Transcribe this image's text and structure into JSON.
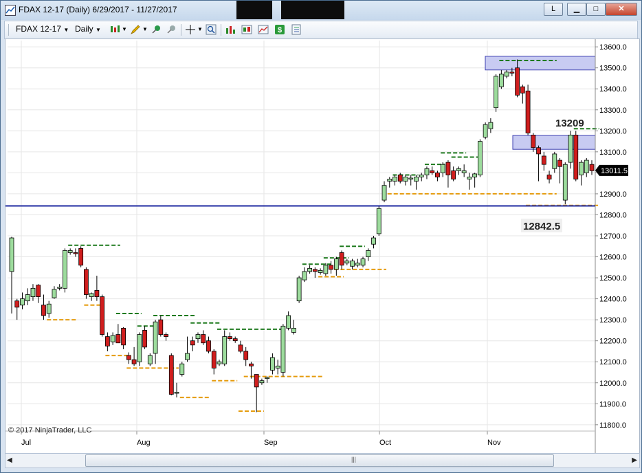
{
  "window": {
    "title": "FDAX 12-17 (Daily)  6/29/2017 - 11/27/2017",
    "buttons": {
      "l": "L",
      "minimize": "▁",
      "maximize": "□",
      "close": "✕"
    }
  },
  "toolbar": {
    "instrument": "FDAX 12-17",
    "interval": "Daily",
    "icons": [
      "candlestick-style-icon",
      "pencil-draw-icon",
      "pin-icon",
      "pin-gray-icon",
      "crosshair-icon",
      "zoom-icon",
      "bar-chart-icon",
      "chart-area-icon",
      "dollar-icon",
      "properties-icon"
    ]
  },
  "chart_data": {
    "type": "candlestick",
    "title": "FDAX 12-17 (Daily)",
    "ylim": [
      11770,
      13630
    ],
    "y_ticks": [
      "13600.0",
      "13500.0",
      "13400.0",
      "13300.0",
      "13200.0",
      "13100.0",
      "13000.0",
      "12900.0",
      "12800.0",
      "12700.0",
      "12600.0",
      "12500.0",
      "12400.0",
      "12300.0",
      "12200.0",
      "12100.0",
      "12000.0",
      "11900.0",
      "11800.0"
    ],
    "x_labels": [
      "Jul",
      "Aug",
      "Sep",
      "Oct",
      "Nov"
    ],
    "last_price": "13011.5",
    "copyright": "© 2017 NinjaTrader, LLC",
    "annotations": {
      "high_label": "13209",
      "low_label": "12842.5"
    },
    "colors": {
      "up": "#9ddc9d",
      "down": "#d01e1e",
      "support_level": "#1f2aa0",
      "resistance": "#1e7a1e",
      "support": "#e59b0c",
      "zone": "#c8cbf2"
    },
    "horizontal_line": 12842.5,
    "zones": [
      {
        "from": 13490,
        "to": 13555
      },
      {
        "from": 13112,
        "to": 13178
      }
    ],
    "candles": [
      {
        "o": 12530,
        "h": 12695,
        "l": 12330,
        "c": 12690
      },
      {
        "o": 12390,
        "h": 12400,
        "l": 12300,
        "c": 12360
      },
      {
        "o": 12370,
        "h": 12430,
        "l": 12350,
        "c": 12400
      },
      {
        "o": 12390,
        "h": 12450,
        "l": 12370,
        "c": 12420
      },
      {
        "o": 12410,
        "h": 12470,
        "l": 12390,
        "c": 12450
      },
      {
        "o": 12465,
        "h": 12470,
        "l": 12380,
        "c": 12410
      },
      {
        "o": 12370,
        "h": 12420,
        "l": 12300,
        "c": 12320
      },
      {
        "o": 12330,
        "h": 12390,
        "l": 12310,
        "c": 12375
      },
      {
        "o": 12405,
        "h": 12460,
        "l": 12400,
        "c": 12445
      },
      {
        "o": 12450,
        "h": 12470,
        "l": 12440,
        "c": 12455
      },
      {
        "o": 12450,
        "h": 12640,
        "l": 12430,
        "c": 12630
      },
      {
        "o": 12620,
        "h": 12640,
        "l": 12610,
        "c": 12630
      },
      {
        "o": 12620,
        "h": 12640,
        "l": 12600,
        "c": 12615
      },
      {
        "o": 12640,
        "h": 12650,
        "l": 12550,
        "c": 12560
      },
      {
        "o": 12540,
        "h": 12550,
        "l": 12400,
        "c": 12420
      },
      {
        "o": 12410,
        "h": 12430,
        "l": 12390,
        "c": 12425
      },
      {
        "o": 12440,
        "h": 12510,
        "l": 12390,
        "c": 12410
      },
      {
        "o": 12410,
        "h": 12420,
        "l": 12220,
        "c": 12230
      },
      {
        "o": 12220,
        "h": 12240,
        "l": 12150,
        "c": 12175
      },
      {
        "o": 12195,
        "h": 12240,
        "l": 12180,
        "c": 12225
      },
      {
        "o": 12230,
        "h": 12280,
        "l": 12200,
        "c": 12190
      },
      {
        "o": 12260,
        "h": 12265,
        "l": 12160,
        "c": 12180
      },
      {
        "o": 12130,
        "h": 12145,
        "l": 12090,
        "c": 12110
      },
      {
        "o": 12110,
        "h": 12170,
        "l": 12080,
        "c": 12090
      },
      {
        "o": 12100,
        "h": 12240,
        "l": 12080,
        "c": 12230
      },
      {
        "o": 12250,
        "h": 12270,
        "l": 12160,
        "c": 12170
      },
      {
        "o": 12090,
        "h": 12140,
        "l": 12080,
        "c": 12130
      },
      {
        "o": 12140,
        "h": 12300,
        "l": 12090,
        "c": 12290
      },
      {
        "o": 12300,
        "h": 12320,
        "l": 12220,
        "c": 12230
      },
      {
        "o": 12230,
        "h": 12240,
        "l": 12200,
        "c": 12220
      },
      {
        "o": 12130,
        "h": 12140,
        "l": 11940,
        "c": 11945
      },
      {
        "o": 11950,
        "h": 12000,
        "l": 11930,
        "c": 11955
      },
      {
        "o": 12040,
        "h": 12100,
        "l": 12030,
        "c": 12090
      },
      {
        "o": 12110,
        "h": 12220,
        "l": 12100,
        "c": 12140
      },
      {
        "o": 12200,
        "h": 12220,
        "l": 12150,
        "c": 12180
      },
      {
        "o": 12210,
        "h": 12240,
        "l": 12190,
        "c": 12230
      },
      {
        "o": 12230,
        "h": 12250,
        "l": 12180,
        "c": 12190
      },
      {
        "o": 12200,
        "h": 12220,
        "l": 12140,
        "c": 12150
      },
      {
        "o": 12150,
        "h": 12160,
        "l": 12040,
        "c": 12070
      },
      {
        "o": 12090,
        "h": 12110,
        "l": 12080,
        "c": 12100
      },
      {
        "o": 12090,
        "h": 12250,
        "l": 12080,
        "c": 12220
      },
      {
        "o": 12220,
        "h": 12240,
        "l": 12200,
        "c": 12210
      },
      {
        "o": 12210,
        "h": 12220,
        "l": 12190,
        "c": 12200
      },
      {
        "o": 12180,
        "h": 12200,
        "l": 12140,
        "c": 12150
      },
      {
        "o": 12150,
        "h": 12170,
        "l": 12080,
        "c": 12110
      },
      {
        "o": 12090,
        "h": 12100,
        "l": 12020,
        "c": 12080
      },
      {
        "o": 12040,
        "h": 12040,
        "l": 11860,
        "c": 11980
      },
      {
        "o": 12000,
        "h": 12020,
        "l": 11990,
        "c": 12010
      },
      {
        "o": 12020,
        "h": 12030,
        "l": 12000,
        "c": 12025
      },
      {
        "o": 12060,
        "h": 12140,
        "l": 12040,
        "c": 12120
      },
      {
        "o": 12070,
        "h": 12110,
        "l": 12040,
        "c": 12080
      },
      {
        "o": 12050,
        "h": 12280,
        "l": 12030,
        "c": 12270
      },
      {
        "o": 12260,
        "h": 12340,
        "l": 12250,
        "c": 12320
      },
      {
        "o": 12240,
        "h": 12300,
        "l": 12230,
        "c": 12260
      },
      {
        "o": 12390,
        "h": 12510,
        "l": 12380,
        "c": 12500
      },
      {
        "o": 12490,
        "h": 12550,
        "l": 12480,
        "c": 12530
      },
      {
        "o": 12530,
        "h": 12560,
        "l": 12520,
        "c": 12545
      },
      {
        "o": 12540,
        "h": 12550,
        "l": 12500,
        "c": 12530
      },
      {
        "o": 12525,
        "h": 12545,
        "l": 12515,
        "c": 12535
      },
      {
        "o": 12520,
        "h": 12570,
        "l": 12510,
        "c": 12560
      },
      {
        "o": 12560,
        "h": 12580,
        "l": 12520,
        "c": 12540
      },
      {
        "o": 12540,
        "h": 12600,
        "l": 12510,
        "c": 12590
      },
      {
        "o": 12620,
        "h": 12630,
        "l": 12540,
        "c": 12560
      },
      {
        "o": 12570,
        "h": 12590,
        "l": 12560,
        "c": 12580
      },
      {
        "o": 12555,
        "h": 12590,
        "l": 12540,
        "c": 12580
      },
      {
        "o": 12560,
        "h": 12590,
        "l": 12550,
        "c": 12570
      },
      {
        "o": 12560,
        "h": 12600,
        "l": 12550,
        "c": 12590
      },
      {
        "o": 12600,
        "h": 12640,
        "l": 12580,
        "c": 12630
      },
      {
        "o": 12660,
        "h": 12700,
        "l": 12640,
        "c": 12690
      },
      {
        "o": 12710,
        "h": 12840,
        "l": 12700,
        "c": 12830
      },
      {
        "o": 12870,
        "h": 12960,
        "l": 12860,
        "c": 12940
      },
      {
        "o": 12960,
        "h": 12980,
        "l": 12930,
        "c": 12970
      },
      {
        "o": 12960,
        "h": 12990,
        "l": 12940,
        "c": 12980
      },
      {
        "o": 12990,
        "h": 13000,
        "l": 12950,
        "c": 12960
      },
      {
        "o": 12960,
        "h": 12990,
        "l": 12940,
        "c": 12980
      },
      {
        "o": 12970,
        "h": 12990,
        "l": 12940,
        "c": 12975
      },
      {
        "o": 12960,
        "h": 12990,
        "l": 12920,
        "c": 12980
      },
      {
        "o": 12980,
        "h": 13000,
        "l": 12960,
        "c": 12990
      },
      {
        "o": 12990,
        "h": 13030,
        "l": 12970,
        "c": 13020
      },
      {
        "o": 13010,
        "h": 13030,
        "l": 12990,
        "c": 13000
      },
      {
        "o": 13000,
        "h": 13010,
        "l": 12960,
        "c": 12980
      },
      {
        "o": 13000,
        "h": 13050,
        "l": 12980,
        "c": 13040
      },
      {
        "o": 13050,
        "h": 13060,
        "l": 12930,
        "c": 12990
      },
      {
        "o": 13010,
        "h": 13030,
        "l": 12960,
        "c": 12970
      },
      {
        "o": 13010,
        "h": 13030,
        "l": 12990,
        "c": 13020
      },
      {
        "o": 13000,
        "h": 13040,
        "l": 12980,
        "c": 13010
      },
      {
        "o": 12970,
        "h": 13000,
        "l": 12920,
        "c": 12980
      },
      {
        "o": 12980,
        "h": 13000,
        "l": 12930,
        "c": 12995
      },
      {
        "o": 12990,
        "h": 13160,
        "l": 12980,
        "c": 13150
      },
      {
        "o": 13170,
        "h": 13240,
        "l": 13160,
        "c": 13230
      },
      {
        "o": 13210,
        "h": 13260,
        "l": 13190,
        "c": 13240
      },
      {
        "o": 13310,
        "h": 13470,
        "l": 13290,
        "c": 13460
      },
      {
        "o": 13410,
        "h": 13490,
        "l": 13400,
        "c": 13470
      },
      {
        "o": 13460,
        "h": 13490,
        "l": 13450,
        "c": 13480
      },
      {
        "o": 13480,
        "h": 13500,
        "l": 13460,
        "c": 13475
      },
      {
        "o": 13500,
        "h": 13540,
        "l": 13360,
        "c": 13370
      },
      {
        "o": 13410,
        "h": 13420,
        "l": 13330,
        "c": 13380
      },
      {
        "o": 13390,
        "h": 13420,
        "l": 13180,
        "c": 13190
      },
      {
        "o": 13180,
        "h": 13190,
        "l": 13100,
        "c": 13120
      },
      {
        "o": 13120,
        "h": 13130,
        "l": 12960,
        "c": 13090
      },
      {
        "o": 13080,
        "h": 13100,
        "l": 13010,
        "c": 13040
      },
      {
        "o": 12990,
        "h": 13010,
        "l": 12950,
        "c": 12970
      },
      {
        "o": 13020,
        "h": 13100,
        "l": 13000,
        "c": 13090
      },
      {
        "o": 13060,
        "h": 13070,
        "l": 12950,
        "c": 13030
      },
      {
        "o": 12870,
        "h": 13050,
        "l": 12850,
        "c": 13040
      },
      {
        "o": 13050,
        "h": 13200,
        "l": 13020,
        "c": 13180
      },
      {
        "o": 13180,
        "h": 13200,
        "l": 12960,
        "c": 12970
      },
      {
        "o": 12990,
        "h": 13060,
        "l": 12940,
        "c": 13050
      },
      {
        "o": 13000,
        "h": 13070,
        "l": 12980,
        "c": 13060
      },
      {
        "o": 13040,
        "h": 13060,
        "l": 12990,
        "c": 13010
      }
    ],
    "resistance_lines": [
      {
        "y": 12655,
        "from": 11,
        "to": 20
      },
      {
        "y": 12330,
        "from": 20,
        "to": 24
      },
      {
        "y": 12270,
        "from": 24,
        "to": 27
      },
      {
        "y": 12320,
        "from": 27,
        "to": 34
      },
      {
        "y": 12285,
        "from": 34,
        "to": 39
      },
      {
        "y": 12255,
        "from": 39,
        "to": 51
      },
      {
        "y": 12565,
        "from": 55,
        "to": 60
      },
      {
        "y": 12595,
        "from": 59,
        "to": 63
      },
      {
        "y": 12650,
        "from": 62,
        "to": 66
      },
      {
        "y": 12990,
        "from": 72,
        "to": 76
      },
      {
        "y": 13040,
        "from": 78,
        "to": 81
      },
      {
        "y": 13095,
        "from": 81,
        "to": 85
      },
      {
        "y": 13075,
        "from": 83,
        "to": 88
      },
      {
        "y": 13535,
        "from": 92,
        "to": 102
      },
      {
        "y": 13210,
        "from": 106,
        "to": 110
      }
    ],
    "support_lines": [
      {
        "y": 12300,
        "from": 7,
        "to": 12
      },
      {
        "y": 12370,
        "from": 14,
        "to": 17
      },
      {
        "y": 12130,
        "from": 18,
        "to": 22
      },
      {
        "y": 12070,
        "from": 22,
        "to": 31
      },
      {
        "y": 11930,
        "from": 32,
        "to": 37
      },
      {
        "y": 12010,
        "from": 38,
        "to": 42
      },
      {
        "y": 11865,
        "from": 43,
        "to": 47
      },
      {
        "y": 12030,
        "from": 44,
        "to": 58
      },
      {
        "y": 12505,
        "from": 58,
        "to": 62
      },
      {
        "y": 12540,
        "from": 61,
        "to": 70
      },
      {
        "y": 12900,
        "from": 71,
        "to": 102
      },
      {
        "y": 12845,
        "from": 97,
        "to": 110
      }
    ]
  }
}
